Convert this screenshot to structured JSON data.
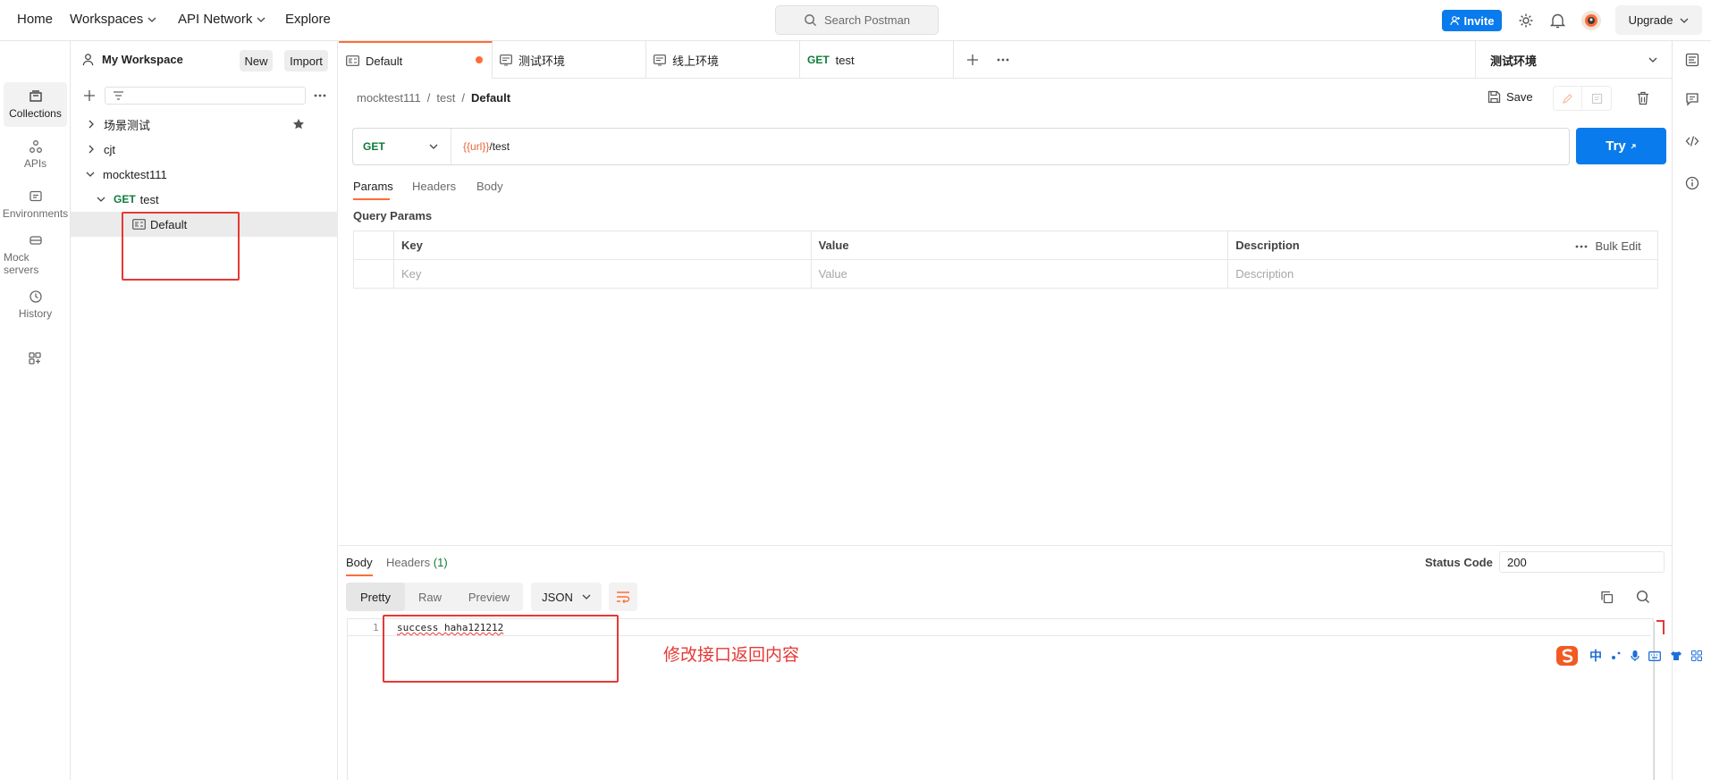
{
  "topnav": {
    "home": "Home",
    "workspaces": "Workspaces",
    "api_network": "API Network",
    "explore": "Explore",
    "search_placeholder": "Search Postman",
    "invite": "Invite",
    "upgrade": "Upgrade"
  },
  "rail": {
    "items": [
      {
        "label": "Collections",
        "icon": "collections-icon"
      },
      {
        "label": "APIs",
        "icon": "apis-icon"
      },
      {
        "label": "Environments",
        "icon": "environments-icon"
      },
      {
        "label": "Mock servers",
        "icon": "mock-servers-icon"
      },
      {
        "label": "History",
        "icon": "history-icon"
      }
    ]
  },
  "sidebar": {
    "workspace": "My Workspace",
    "new": "New",
    "import": "Import",
    "tree": [
      {
        "label": "场景测试",
        "starred": true
      },
      {
        "label": "cjt"
      },
      {
        "label": "mocktest111"
      },
      {
        "method": "GET",
        "label": "test"
      },
      {
        "label": "Default"
      }
    ]
  },
  "tabs": [
    {
      "label": "Default",
      "unsaved": true
    },
    {
      "label": "测试环境"
    },
    {
      "label": "线上环境"
    },
    {
      "method": "GET",
      "label": "test"
    }
  ],
  "environment": "测试环境",
  "breadcrumb": {
    "a": "mocktest111",
    "sep": "/",
    "b": "test",
    "c": "Default"
  },
  "save": "Save",
  "request": {
    "method": "GET",
    "url_var": "{{url}}",
    "url_path": "/test",
    "try": "Try"
  },
  "req_tabs": [
    "Params",
    "Headers",
    "Body"
  ],
  "query_params": {
    "title": "Query Params",
    "headers": [
      "Key",
      "Value",
      "Description"
    ],
    "bulk_edit": "Bulk Edit",
    "placeholders": [
      "Key",
      "Value",
      "Description"
    ]
  },
  "response": {
    "tab_body": "Body",
    "tab_headers": "Headers",
    "headers_count": "(1)",
    "status_code_label": "Status Code",
    "status_code": "200",
    "views": [
      "Pretty",
      "Raw",
      "Preview"
    ],
    "format": "JSON",
    "line_no": "1",
    "content": "success haha121212"
  },
  "annotation": "修改接口返回内容",
  "ime": {
    "zh": "中"
  },
  "colors": {
    "accent": "#ff6c37",
    "blue": "#097bed",
    "get": "#0f7b3a",
    "annotation": "#e53935"
  }
}
